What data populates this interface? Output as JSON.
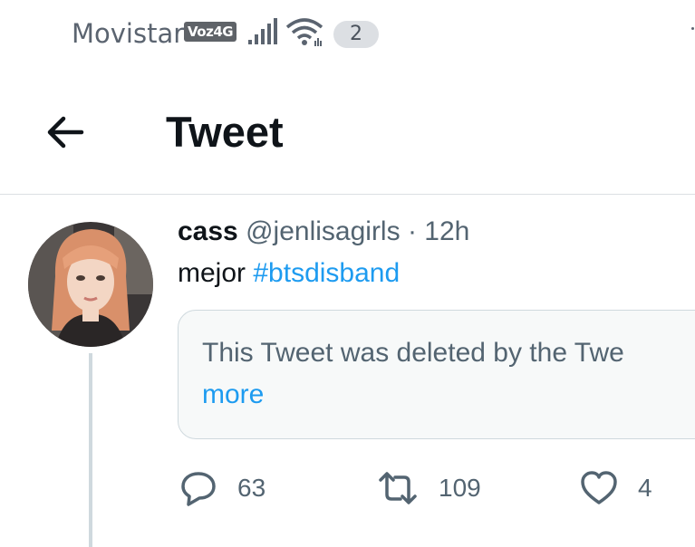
{
  "status_bar": {
    "carrier": "Movistar",
    "network_badge": "Voz4G",
    "notification_count": "2",
    "icons": [
      "signal-icon",
      "wifi-icon"
    ]
  },
  "header": {
    "title": "Tweet",
    "back_icon": "back-arrow-icon"
  },
  "tweet": {
    "name": "cass",
    "handle": "@jenlisagirls",
    "separator": "·",
    "time": "12h",
    "text": "mejor",
    "hashtag": "#btsdisband",
    "quoted": {
      "text": "This Tweet was deleted by the Twe",
      "more_link": "more"
    },
    "actions": {
      "replies": "63",
      "retweets": "109",
      "likes": "4"
    }
  },
  "colors": {
    "accent": "#1d9bf0",
    "text_primary": "#0f1419",
    "text_secondary": "#536471",
    "border": "#cfd9de"
  }
}
